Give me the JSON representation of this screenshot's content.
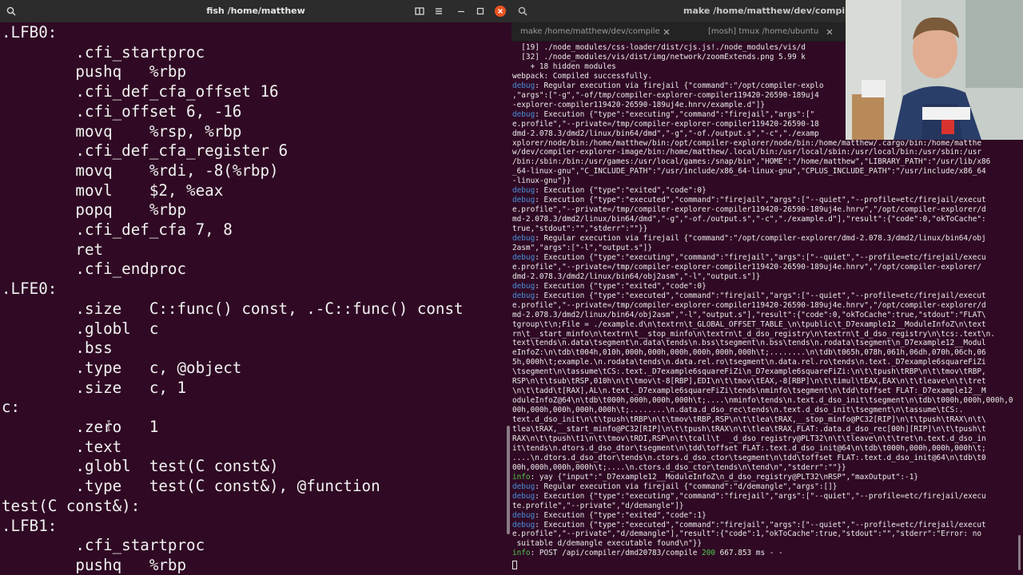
{
  "left_window": {
    "title": "fish /home/matthew",
    "lines": [
      ".LFB0:",
      "        .cfi_startproc",
      "        pushq   %rbp",
      "        .cfi_def_cfa_offset 16",
      "        .cfi_offset 6, -16",
      "        movq    %rsp, %rbp",
      "        .cfi_def_cfa_register 6",
      "        movq    %rdi, -8(%rbp)",
      "        movl    $2, %eax",
      "        popq    %rbp",
      "        .cfi_def_cfa 7, 8",
      "        ret",
      "        .cfi_endproc",
      ".LFE0:",
      "        .size   C::func() const, .-C::func() const",
      "        .globl  c",
      "        .bss",
      "        .type   c, @object",
      "        .size   c, 1",
      "c:",
      "        .zero   1",
      "        .text",
      "        .globl  test(C const&)",
      "        .type   test(C const&), @function",
      "test(C const&):",
      ".LFB1:",
      "        .cfi_startproc",
      "        pushq   %rbp"
    ]
  },
  "right_window": {
    "title": "make /home/matthew/dev/compiler-explorer",
    "tabs": [
      {
        "label": "make /home/matthew/dev/compile..."
      },
      {
        "label": "[mosh] tmux /home/ubuntu"
      }
    ],
    "log": [
      {
        "text": "  [19] ./node_modules/css-loader/dist/cjs.js!./node_modules/vis/d"
      },
      {
        "text": "  [32] ./node_modules/vis/dist/img/network/zoomExtends.png 5.99 k"
      },
      {
        "text": "    + 18 hidden modules"
      },
      {
        "text": "webpack: Compiled successfully."
      },
      {
        "level": "debug",
        "text": ": Regular execution via firejail {\"command\":\"/opt/compiler-explo"
      },
      {
        "text": ",\"args\":[\"-g\",\"-of/tmp/compiler-explorer-compiler119420-26590-189uj4"
      },
      {
        "text": "-explorer-compiler119420-26590-189uj4e.hnrv/example.d\"]}"
      },
      {
        "level": "debug",
        "text": ": Execution {\"type\":\"executing\",\"command\":\"firejail\",\"args\":[\""
      },
      {
        "text": "e.profile\",\"--private=/tmp/compiler-explorer-compiler119420-26590-18"
      },
      {
        "text": "dmd-2.078.3/dmd2/linux/bin64/dmd\",\"-g\",\"-of./output.s\",\"-c\",\"./examp"
      },
      {
        "text": "xplorer/node/bin:/home/matthew/bin:/opt/compiler-explorer/node/bin:/home/matthew/.cargo/bin:/home/matthe"
      },
      {
        "text": "w/dev/compiler-explorer-image/bin:/home/matthew/.local/bin:/usr/local/sbin:/usr/local/bin:/usr/sbin:/usr"
      },
      {
        "text": "/bin:/sbin:/bin:/usr/games:/usr/local/games:/snap/bin\",\"HOME\":\"/home/matthew\",\"LIBRARY_PATH\":\"/usr/lib/x86"
      },
      {
        "text": "_64-linux-gnu\",\"C_INCLUDE_PATH\":\"/usr/include/x86_64-linux-gnu\",\"CPLUS_INCLUDE_PATH\":\"/usr/include/x86_64"
      },
      {
        "text": "-linux-gnu\"}}"
      },
      {
        "level": "debug",
        "text": ": Execution {\"type\":\"exited\",\"code\":0}"
      },
      {
        "level": "debug",
        "text": ": Execution {\"type\":\"executed\",\"command\":\"firejail\",\"args\":[\"--quiet\",\"--profile=etc/firejail/execut"
      },
      {
        "text": "e.profile\",\"--private=/tmp/compiler-explorer-compiler119420-26590-189uj4e.hnrv\",\"/opt/compiler-explorer/d"
      },
      {
        "text": "md-2.078.3/dmd2/linux/bin64/dmd\",\"-g\",\"-of./output.s\",\"-c\",\"./example.d\"],\"result\":{\"code\":0,\"okToCache\":"
      },
      {
        "text": "true,\"stdout\":\"\",\"stderr\":\"\"}}"
      },
      {
        "level": "debug",
        "text": ": Regular execution via firejail {\"command\":\"/opt/compiler-explorer/dmd-2.078.3/dmd2/linux/bin64/obj"
      },
      {
        "text": "2asm\",\"args\":[\"-l\",\"output.s\"]}"
      },
      {
        "level": "debug",
        "text": ": Execution {\"type\":\"executing\",\"command\":\"firejail\",\"args\":[\"--quiet\",\"--profile=etc/firejail/execu"
      },
      {
        "text": "e.profile\",\"--private=/tmp/compiler-explorer-compiler119420-26590-189uj4e.hnrv\",\"/opt/compiler-explorer/"
      },
      {
        "text": "dmd-2.078.3/dmd2/linux/bin64/obj2asm\",\"-l\",\"output.s\"]}"
      },
      {
        "level": "debug",
        "text": ": Execution {\"type\":\"exited\",\"code\":0}"
      },
      {
        "level": "debug",
        "text": ": Execution {\"type\":\"executed\",\"command\":\"firejail\",\"args\":[\"--quiet\",\"--profile=etc/firejail/execut"
      },
      {
        "text": "e.profile\",\"--private=/tmp/compiler-explorer-compiler119420-26590-189uj4e.hnrv\",\"/opt/compiler-explorer/d"
      },
      {
        "text": "md-2.078.3/dmd2/linux/bin64/obj2asm\",\"-l\",\"output.s\"],\"result\":{\"code\":0,\"okToCache\":true,\"stdout\":\"FLAT\\"
      },
      {
        "text": "tgroup\\t\\n;File = ./example.d\\n\\textrn\\t_GLOBAL_OFFSET_TABLE_\\n\\tpublic\\t_D7example12__ModuleInfoZ\\n\\text"
      },
      {
        "text": "rn\\t__start_minfo\\n\\textrn\\t__stop_minfo\\n\\textrn\\t_d_dso_registry\\n\\textrn\\t_d_dso_registry\\n\\tcs:.text\\n."
      },
      {
        "text": "text\\tends\\n.data\\tsegment\\n.data\\tends\\n.bss\\tsegment\\n.bss\\tends\\n.rodata\\tsegment\\n_D7example12__Modul"
      },
      {
        "text": "eInfoZ:\\n\\tdb\\t004h,010h,000h,000h,000h,000h,000h,000h\\t;........\\n\\tdb\\t065h,078h,061h,06dh,070h,06ch,06"
      },
      {
        "text": "5h,000h\\t;example.\\n.rodata\\tends\\n.data.rel.ro\\tsegment\\n.data.rel.ro\\tends\\n.text._D7example6squareFiZi"
      },
      {
        "text": "\\tsegment\\n\\tassume\\tCS:.text._D7example6squareFiZi\\n_D7example6squareFiZi:\\n\\t\\tpush\\tRBP\\n\\t\\tmov\\tRBP,"
      },
      {
        "text": "RSP\\n\\t\\tsub\\tRSP,010h\\n\\t\\tmov\\t-8[RBP],EDI\\n\\t\\tmov\\tEAX,-8[RBP]\\n\\t\\timul\\tEAX,EAX\\n\\t\\tleave\\n\\t\\tret"
      },
      {
        "text": "\\n\\t\\tadd\\t[RAX],AL\\n.text._D7example6squareFiZi\\tends\\nminfo\\tsegment\\n\\tdd\\toffset FLAT:_D7example12__M"
      },
      {
        "text": "oduleInfoZ@64\\n\\tdb\\t000h,000h,000h,000h\\t;....\\nminfo\\tends\\n.text.d_dso_init\\tsegment\\n\\tdb\\t000h,000h,000h,0"
      },
      {
        "text": "00h,000h,000h,000h,000h\\t;........\\n.data.d_dso_rec\\tends\\n.text.d_dso_init\\tsegment\\n\\tassume\\tCS:."
      },
      {
        "text": "text.d_dso_init\\n\\t\\tpush\\tRBP\\n\\t\\tmov\\tRBP,RSP\\n\\t\\tlea\\tRAX,__stop_minfo@PC32[RIP]\\n\\t\\tpush\\tRAX\\n\\t\\"
      },
      {
        "text": "tlea\\tRAX,__start_minfo@PC32[RIP]\\n\\t\\tpush\\tRAX\\n\\t\\tlea\\tRAX,FLAT:.data.d_dso_rec[00h][RIP]\\n\\t\\tpush\\t"
      },
      {
        "text": "RAX\\n\\t\\tpush\\t1\\n\\t\\tmov\\tRDI,RSP\\n\\t\\tcall\\t  _d_dso_registry@PLT32\\n\\t\\tleave\\n\\t\\tret\\n.text.d_dso_in"
      },
      {
        "text": "it\\tends\\n.dtors.d_dso_dtor\\tsegment\\n\\tdd\\toffset FLAT:.text.d_dso_init@64\\n\\tdb\\t000h,000h,000h,000h\\t;"
      },
      {
        "text": "....\\n.dtors.d_dso_dtor\\tends\\n.ctors.d_dso_ctor\\tsegment\\n\\tdd\\toffset FLAT:.text.d_dso_init@64\\n\\tdb\\t0"
      },
      {
        "text": "00h,000h,000h,000h\\t;....\\n.ctors.d_dso_ctor\\tends\\n\\tend\\n\",\"stderr\":\"\"}}"
      },
      {
        "level": "info",
        "text": ": yay {\"input\":\"_D7example12__ModuleInfoZ\\n_d_dso_registry@PLT32\\nRSP\",\"maxOutput\":-1}"
      },
      {
        "level": "debug",
        "text": ": Regular execution via firejail {\"command\":\"d/demangle\",\"args\":[]}"
      },
      {
        "level": "debug",
        "text": ": Execution {\"type\":\"executing\",\"command\":\"firejail\",\"args\":[\"--quiet\",\"--profile=etc/firejail/execu"
      },
      {
        "text": "te.profile\",\"--private\",\"d/demangle\"]}"
      },
      {
        "level": "debug",
        "text": ": Execution {\"type\":\"exited\",\"code\":1}"
      },
      {
        "level": "debug",
        "text": ": Execution {\"type\":\"executed\",\"command\":\"firejail\",\"args\":[\"--quiet\",\"--profile=etc/firejail/execut"
      },
      {
        "text": "e.profile\",\"--private\",\"d/demangle\"],\"result\":{\"code\":1,\"okToCache\":true,\"stdout\":\"\",\"stderr\":\"Error: no"
      },
      {
        "text": " suitable d/demangle executable found\\n\"}}"
      },
      {
        "level": "info",
        "text": ": POST /api/compiler/dmd20783/compile ",
        "status": "200",
        "tail": " 667.853 ms - -"
      }
    ]
  },
  "colors": {
    "terminal_bg": "#300a24",
    "titlebar_bg": "#2c2c2c",
    "close_button": "#e95420",
    "debug_label": "#4a8fdc",
    "info_label": "#4cc44c"
  },
  "icons": {
    "left_search": "search-icon",
    "left_split": "split-view-icon",
    "left_menu": "hamburger-menu-icon",
    "right_search": "search-icon"
  }
}
